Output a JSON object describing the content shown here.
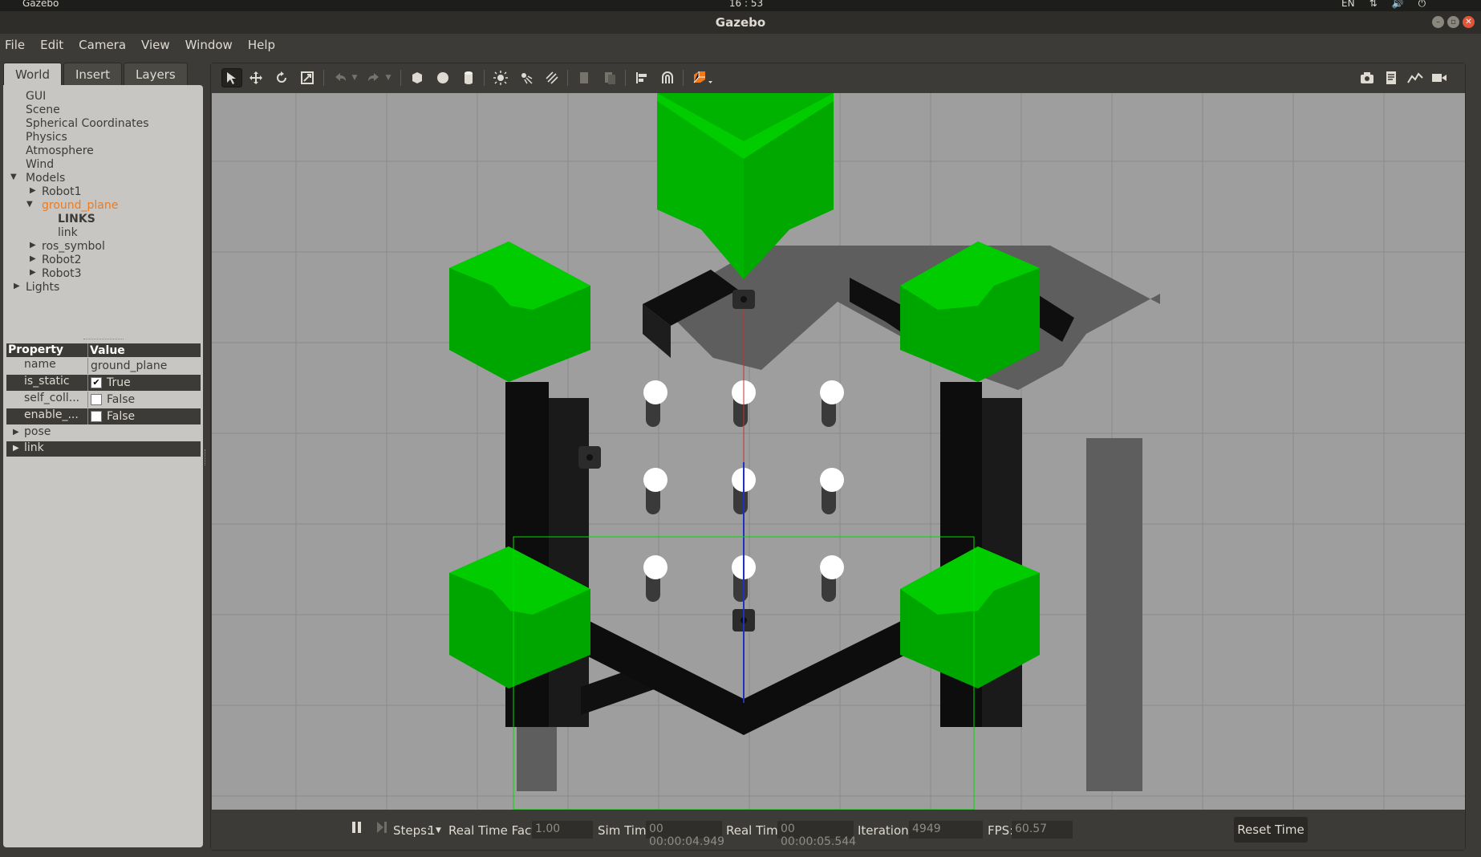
{
  "system": {
    "app_menu": "Gazebo",
    "clock": "16 : 53",
    "lang": "EN"
  },
  "window": {
    "title": "Gazebo"
  },
  "menu": [
    "File",
    "Edit",
    "Camera",
    "View",
    "Window",
    "Help"
  ],
  "tabs": [
    "World",
    "Insert",
    "Layers"
  ],
  "tree": [
    {
      "label": "GUI",
      "indent": 0
    },
    {
      "label": "Scene",
      "indent": 0
    },
    {
      "label": "Spherical Coordinates",
      "indent": 0
    },
    {
      "label": "Physics",
      "indent": 0
    },
    {
      "label": "Atmosphere",
      "indent": 0
    },
    {
      "label": "Wind",
      "indent": 0
    },
    {
      "label": "Models",
      "indent": 0
    },
    {
      "label": "Robot1",
      "indent": 1
    },
    {
      "label": "ground_plane",
      "indent": 1
    },
    {
      "label": "LINKS",
      "indent": 2
    },
    {
      "label": "link",
      "indent": 2
    },
    {
      "label": "ros_symbol",
      "indent": 1
    },
    {
      "label": "Robot2",
      "indent": 1
    },
    {
      "label": "Robot3",
      "indent": 1
    },
    {
      "label": "Lights",
      "indent": 0
    }
  ],
  "properties": {
    "header_property": "Property",
    "header_value": "Value",
    "rows": [
      {
        "name": "name",
        "value": "ground_plane"
      },
      {
        "name": "is_static",
        "value": "True",
        "checked": true
      },
      {
        "name": "self_coll...",
        "value": "False",
        "checked": false
      },
      {
        "name": "enable_...",
        "value": "False",
        "checked": false
      }
    ],
    "groups": [
      "pose",
      "link"
    ]
  },
  "toolbar_icons": [
    "select-mode-icon",
    "translate-mode-icon",
    "rotate-mode-icon",
    "scale-mode-icon",
    "undo-icon",
    "undo-dropdown-icon",
    "redo-icon",
    "redo-dropdown-icon",
    "box-shape-icon",
    "sphere-shape-icon",
    "cylinder-shape-icon",
    "point-light-icon",
    "spot-light-icon",
    "directional-light-icon",
    "copy-icon",
    "paste-icon",
    "align-icon",
    "snap-icon",
    "view-angle-icon",
    "screenshot-icon",
    "log-icon",
    "plot-icon",
    "video-record-icon"
  ],
  "bottom": {
    "steps_label": "Steps:",
    "steps_value": "1",
    "rtf_label": "Real Time Factor:",
    "rtf_value": "1.00",
    "sim_time_label": "Sim Time:",
    "sim_time_value": "00 00:00:04.949",
    "real_time_label": "Real Time:",
    "real_time_value": "00 00:00:05.544",
    "iterations_label": "Iterations:",
    "iterations_value": "4949",
    "fps_label": "FPS:",
    "fps_value": "60.57",
    "reset_label": "Reset Time"
  },
  "colors": {
    "ground": "#9e9e9e",
    "grid": "#8a8a8a",
    "green": "#00b300",
    "wall": "#141414",
    "accent": "#f07a1a"
  }
}
